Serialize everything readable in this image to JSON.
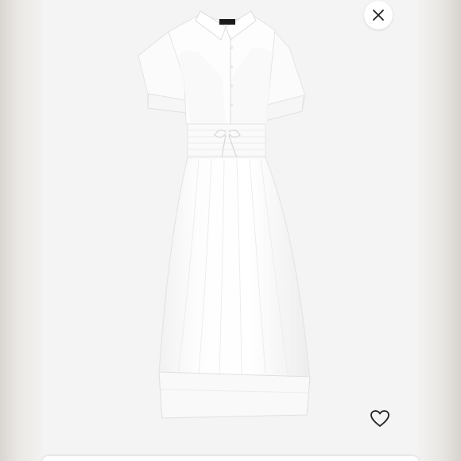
{
  "viewer": {
    "brand_tag": "J.CREW",
    "close_icon": "close-icon",
    "favorite_icon": "heart-outline-icon"
  },
  "colors": {
    "backdrop": "#f4f4f4",
    "garment": "#fdfdfd",
    "shadow": "#e6e6e6",
    "button_bg": "#ffffff",
    "icon": "#222222"
  }
}
